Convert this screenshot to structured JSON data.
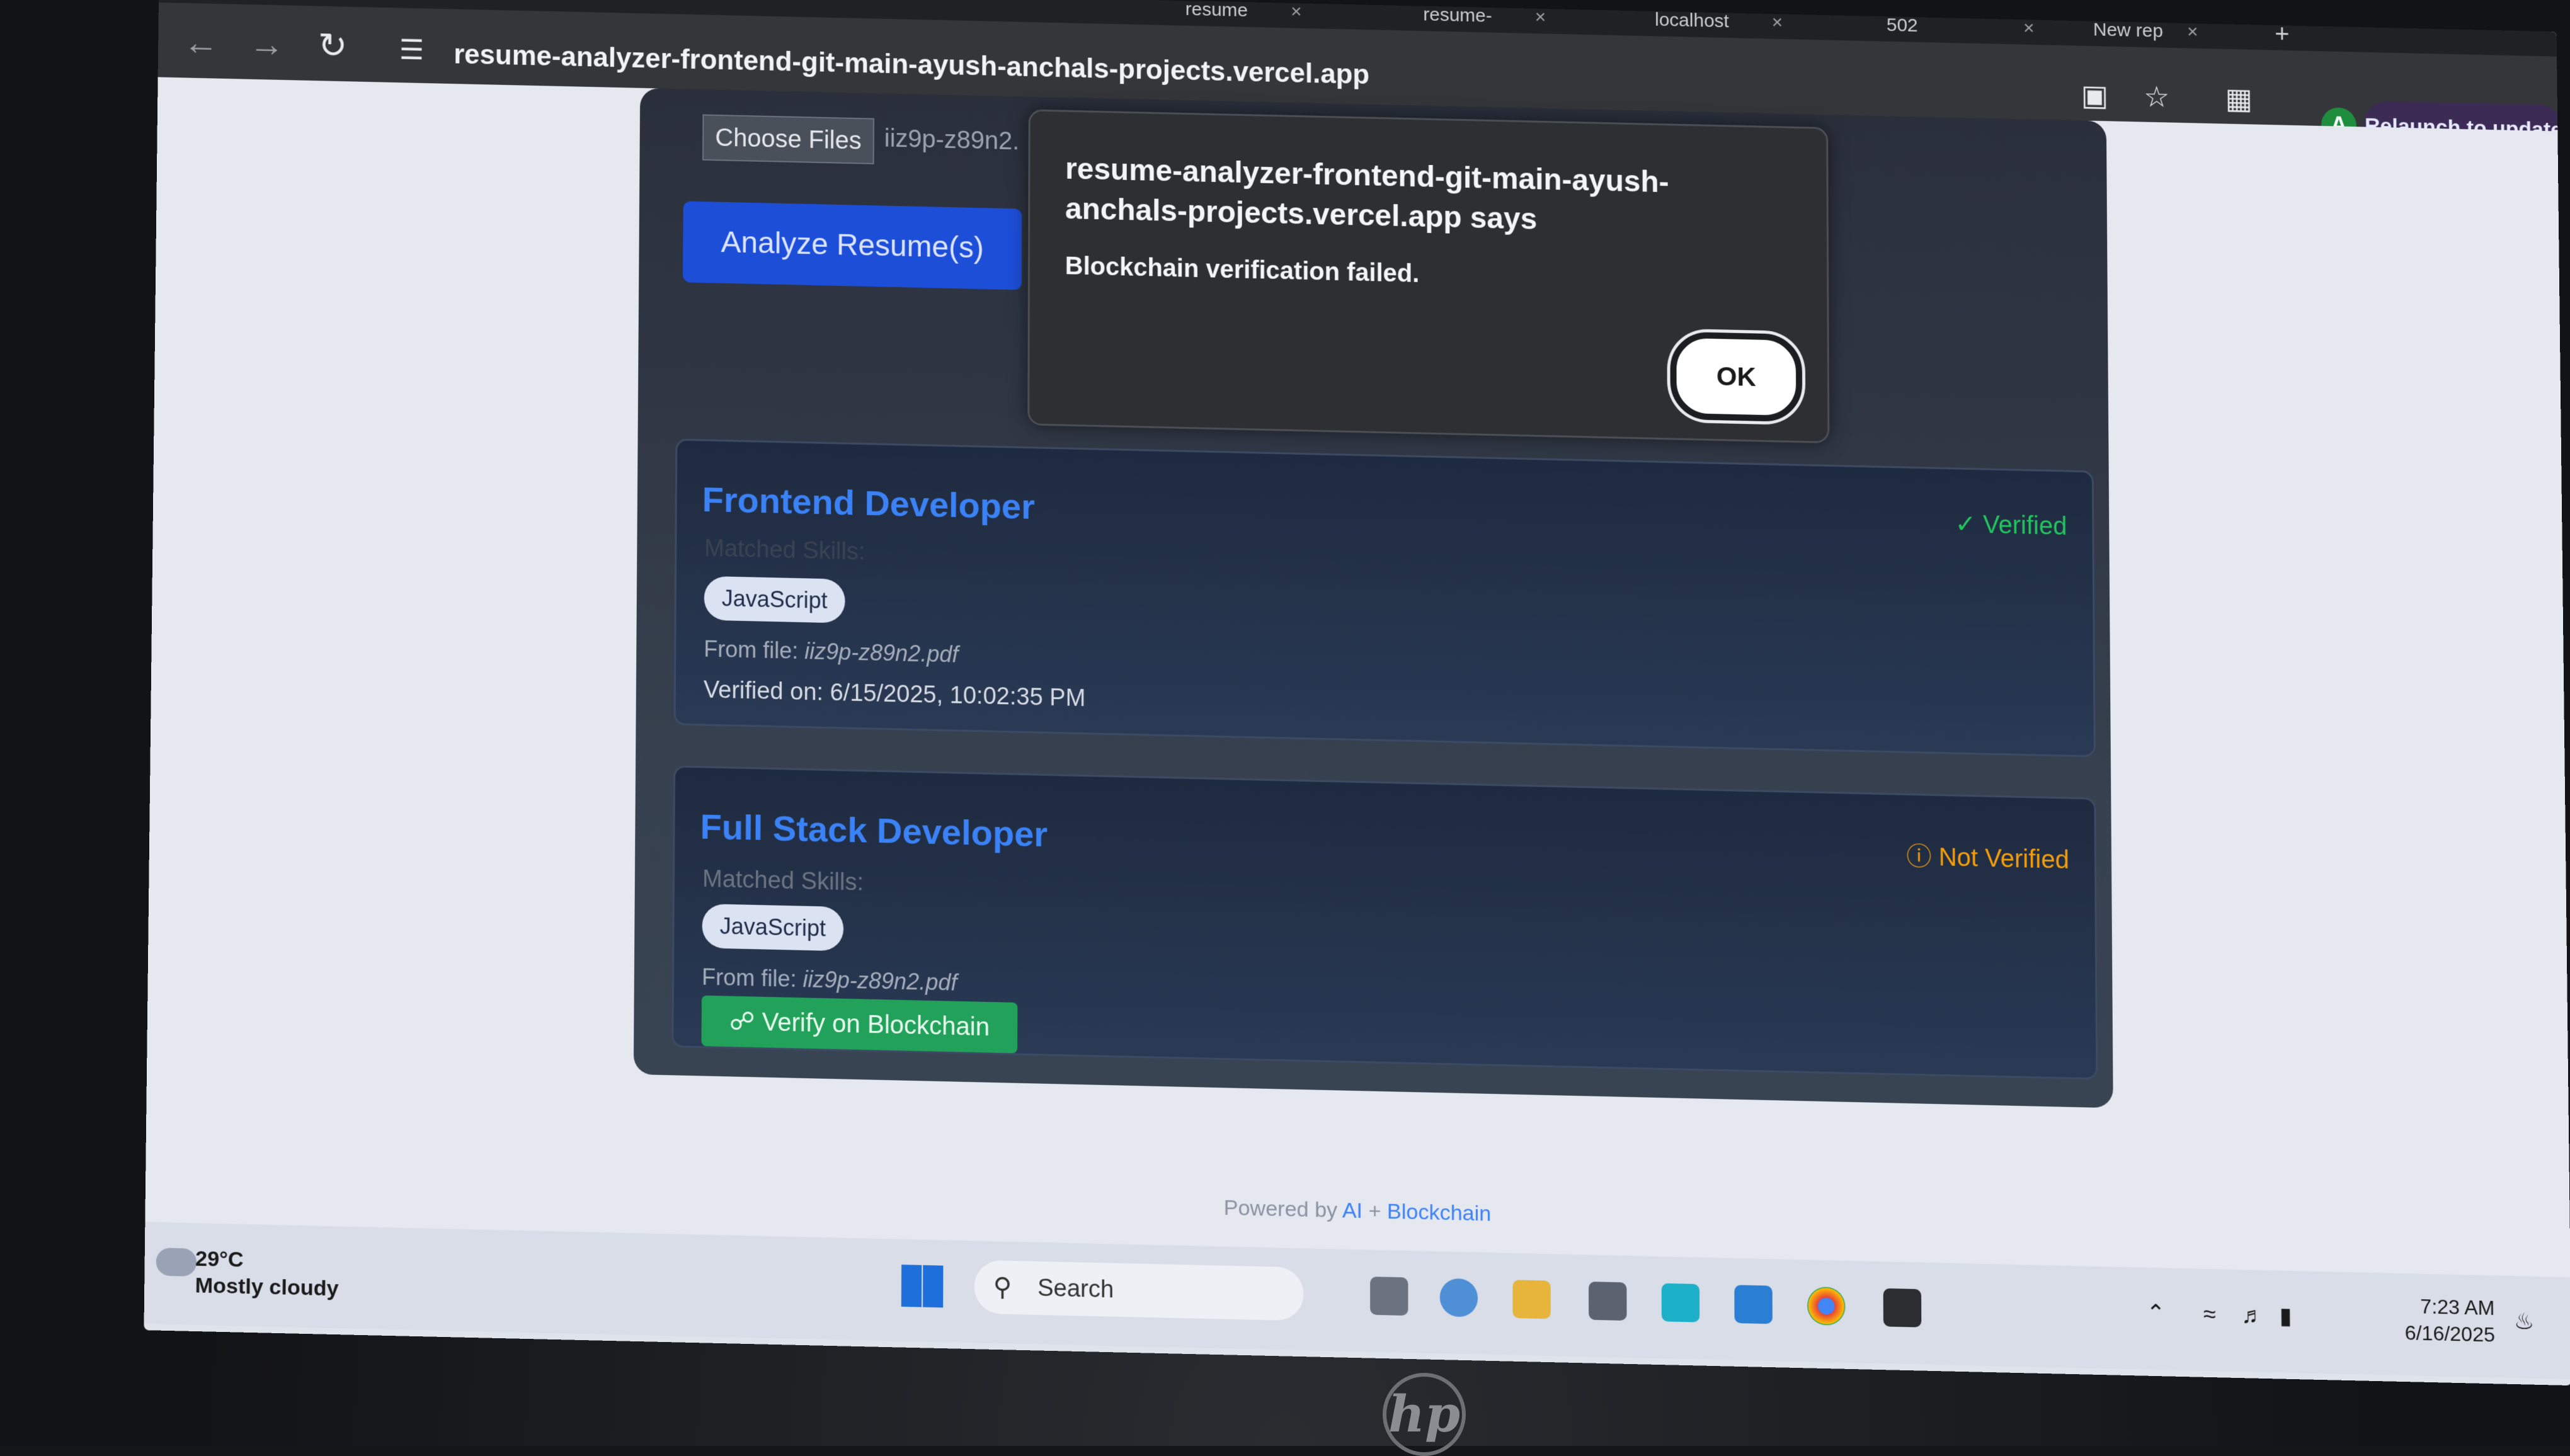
{
  "browser": {
    "tabs": [
      {
        "label": "resume",
        "close": "×"
      },
      {
        "label": "resume-",
        "close": "×"
      },
      {
        "label": "localhost",
        "close": "×"
      },
      {
        "label": "502",
        "close": "×"
      },
      {
        "label": "New rep",
        "close": "×"
      }
    ],
    "new_tab_symbol": "+",
    "url": "resume-analyzer-frontend-git-main-ayush-anchals-projects.vercel.app",
    "profile_initial": "A",
    "relaunch_label": "Relaunch to update"
  },
  "upload": {
    "choose_files_label": "Choose Files",
    "selected_file": "iiz9p-z89n2.",
    "analyze_label": "Analyze Resume(s)"
  },
  "results": [
    {
      "title": "Frontend Developer",
      "status": "Verified",
      "matched_label": "Matched Skills:",
      "skills": [
        "JavaScript"
      ],
      "from_label": "From file:",
      "file": "iiz9p-z89n2.pdf",
      "verified_on": "Verified on: 6/15/2025, 10:02:35 PM"
    },
    {
      "title": "Full Stack Developer",
      "status": "Not Verified",
      "matched_label": "Matched Skills:",
      "skills": [
        "JavaScript"
      ],
      "from_label": "From file:",
      "file": "iiz9p-z89n2.pdf",
      "verify_button": "Verify on Blockchain"
    }
  ],
  "footer": {
    "powered_prefix": "Powered by",
    "powered_ai": "AI",
    "powered_plus": "+",
    "powered_chain": "Blockchain"
  },
  "dialog": {
    "title": "resume-analyzer-frontend-git-main-ayush-anchals-projects.vercel.app says",
    "message": "Blockchain verification failed.",
    "ok_label": "OK"
  },
  "taskbar": {
    "temperature": "29°C",
    "weather": "Mostly cloudy",
    "search_label": "Search",
    "time": "7:23 AM",
    "date": "6/16/2025"
  },
  "device": {
    "brand_logo": "hp"
  },
  "colors": {
    "accent_blue": "#3b82f6",
    "verified_green": "#22c55e",
    "not_verified_amber": "#f59e0b",
    "verify_button_green": "#22a15a"
  }
}
